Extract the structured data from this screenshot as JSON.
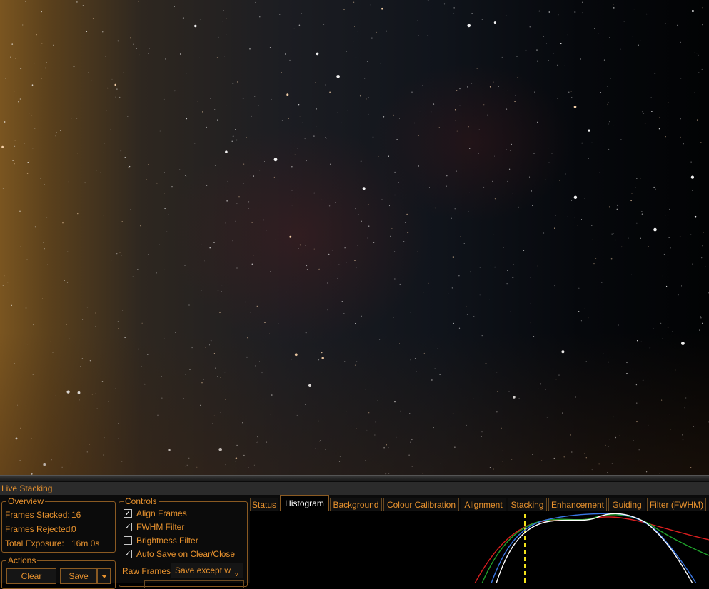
{
  "panel": {
    "title": "Live Stacking"
  },
  "overview": {
    "legend": "Overview",
    "frames_stacked_label": "Frames Stacked:",
    "frames_stacked_value": "16",
    "frames_rejected_label": "Frames Rejected:",
    "frames_rejected_value": "0",
    "total_exposure_label": "Total Exposure:",
    "total_exposure_value": "16m 0s"
  },
  "controls": {
    "legend": "Controls",
    "checkboxes": [
      {
        "label": "Align Frames",
        "checked": true
      },
      {
        "label": "FWHM Filter",
        "checked": true
      },
      {
        "label": "Brightness Filter",
        "checked": false
      },
      {
        "label": "Auto Save on Clear/Close",
        "checked": true
      }
    ],
    "raw_frames_label": "Raw Frames",
    "raw_frames_value": "Save except w"
  },
  "actions": {
    "legend": "Actions",
    "clear_label": "Clear",
    "save_label": "Save"
  },
  "tabs": [
    "Status",
    "Histogram",
    "Background",
    "Colour Calibration",
    "Alignment",
    "Stacking",
    "Enhancement",
    "Guiding",
    "Filter (FWHM)"
  ],
  "active_tab": "Histogram",
  "colors": {
    "accent": "#e8922e",
    "histogram_red": "#d81e1e",
    "histogram_green": "#1fa02a",
    "histogram_blue": "#3a78e6",
    "histogram_luminance": "#ffffff",
    "marker": "#f2e21a"
  }
}
